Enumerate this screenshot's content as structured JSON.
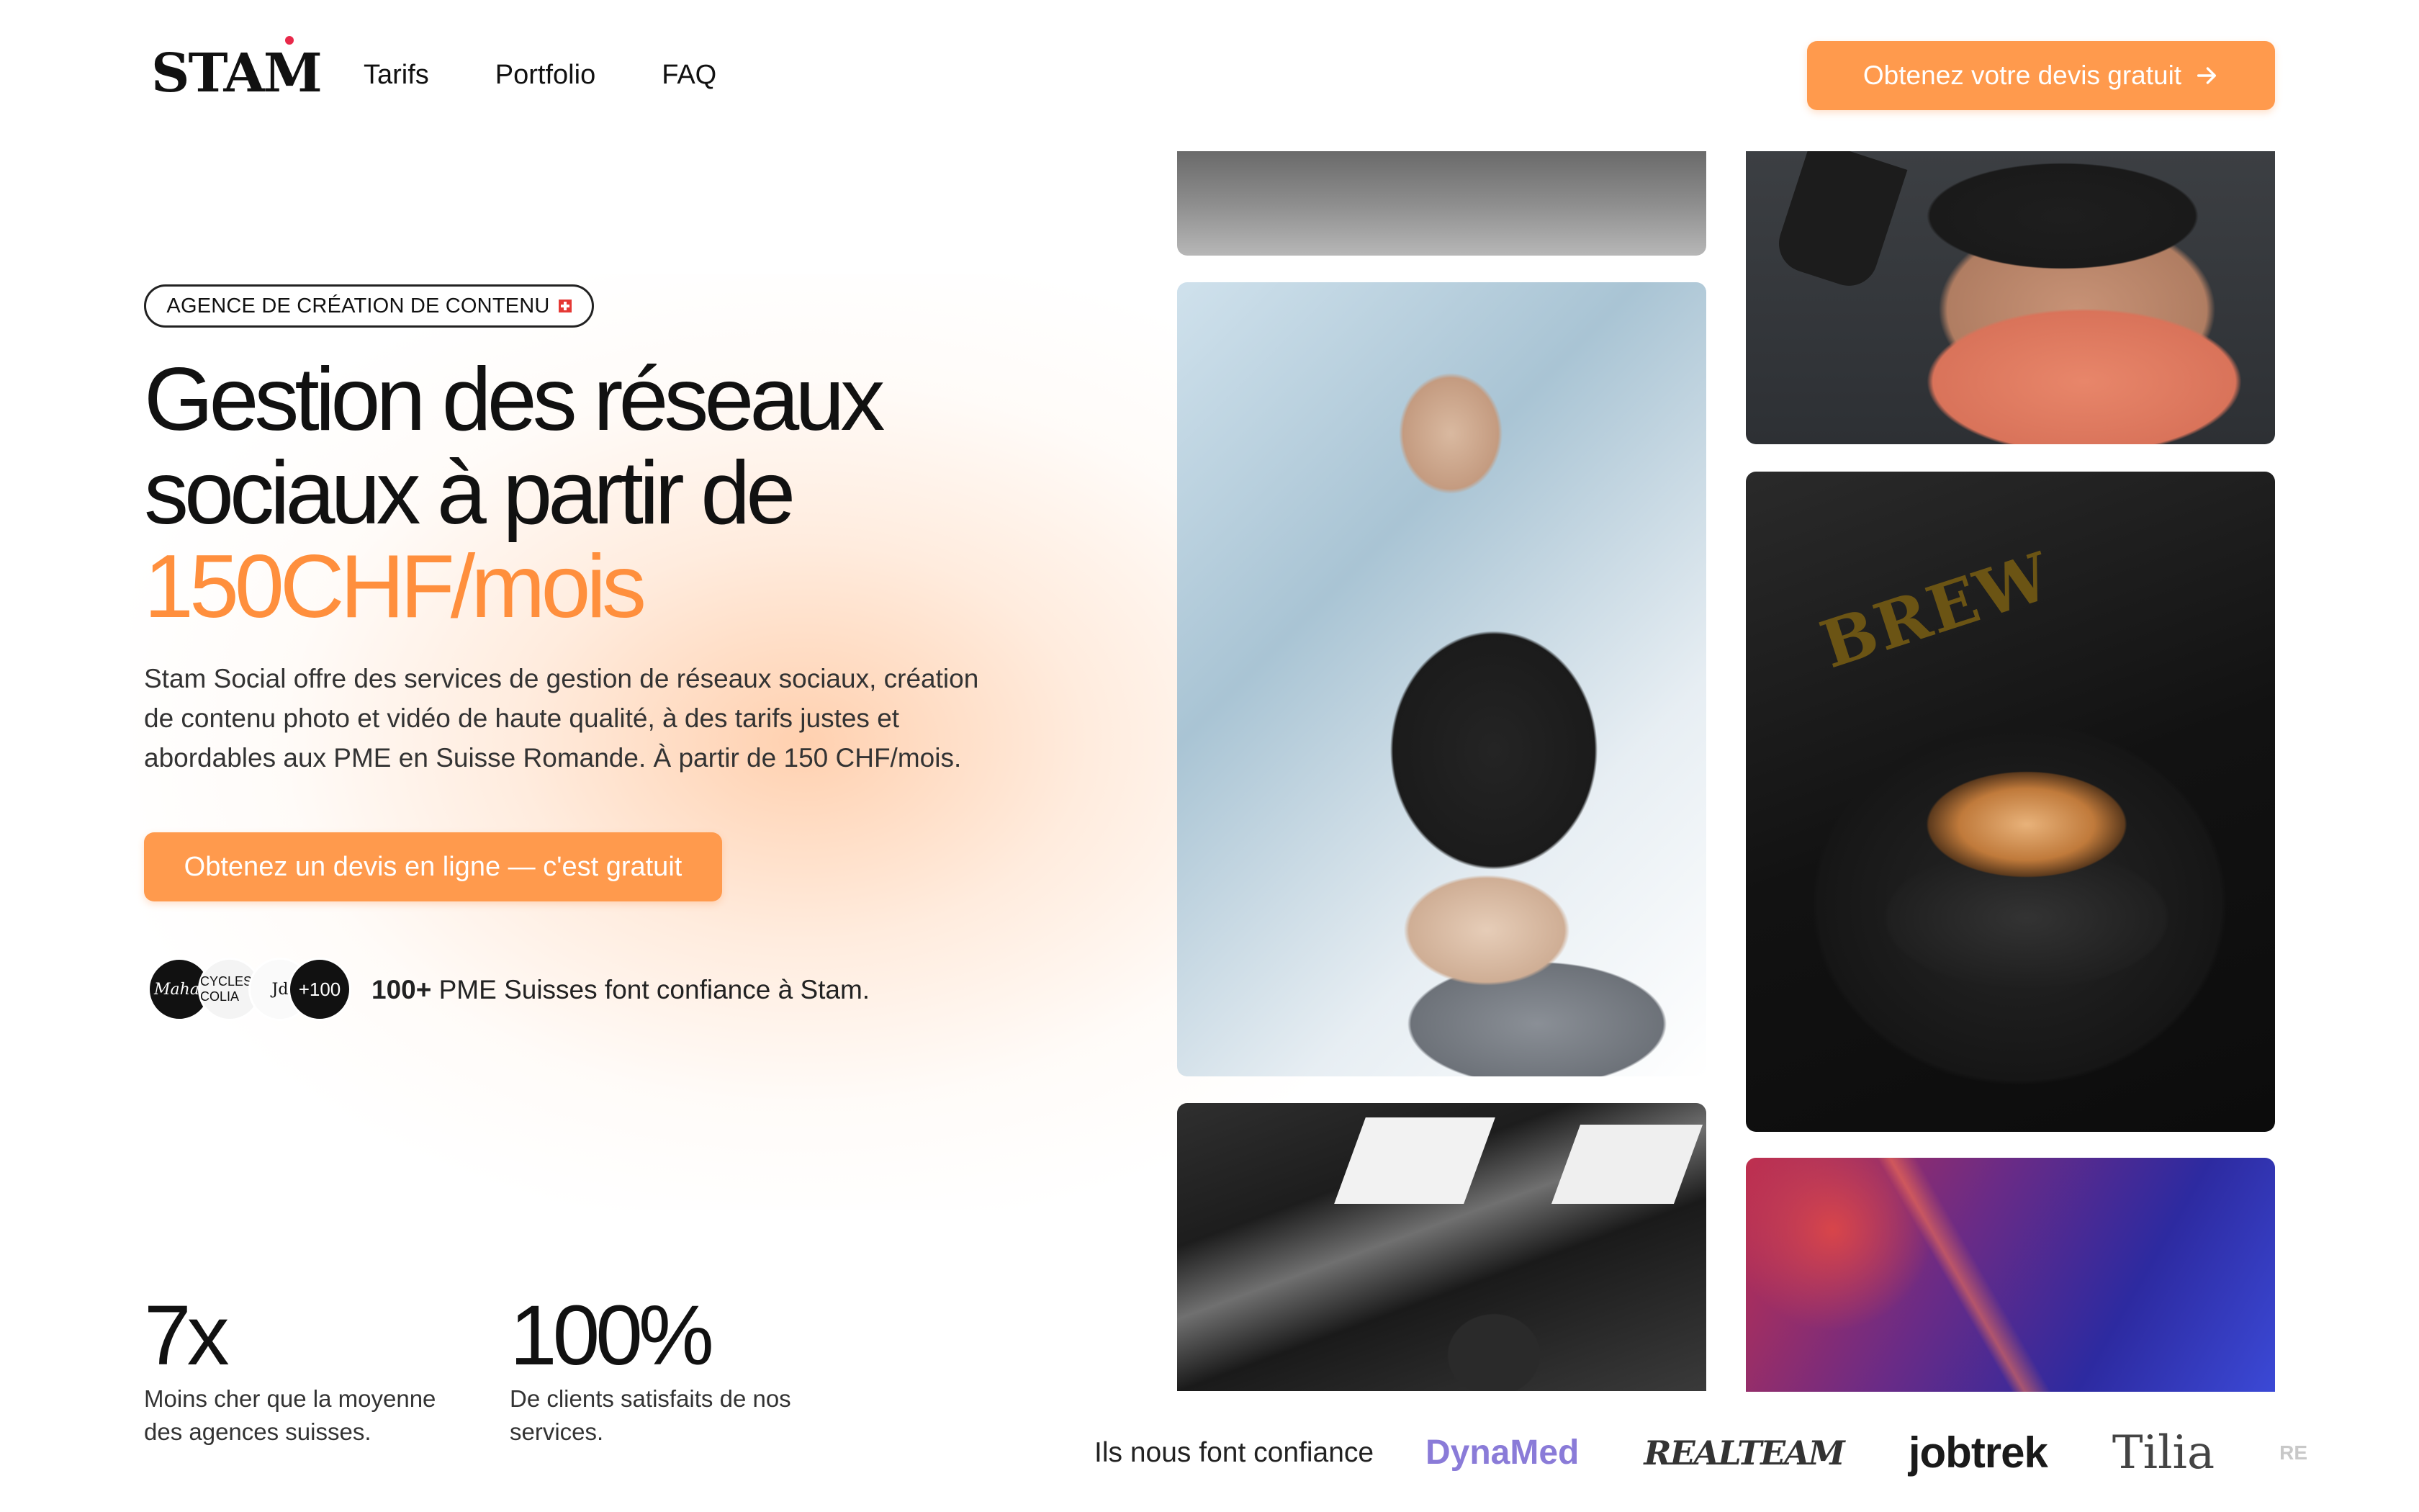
{
  "header": {
    "logo": "STAM",
    "nav": [
      {
        "label": "Tarifs"
      },
      {
        "label": "Portfolio"
      },
      {
        "label": "FAQ"
      }
    ],
    "cta_label": "Obtenez votre devis gratuit",
    "cta_icon": "arrow-right-icon"
  },
  "hero": {
    "badge": "AGENCE DE CRÉATION DE CONTENU",
    "headline_line1": "Gestion des réseaux",
    "headline_line2": "sociaux à partir de",
    "headline_price": "150CHF/mois",
    "description": "Stam Social offre des services de gestion de réseaux sociaux, création de contenu photo et vidéo de haute qualité, à des tarifs justes et abordables aux PME en Suisse Romande. À partir de 150 CHF/mois.",
    "cta_label": "Obtenez un devis en ligne — c'est gratuit",
    "accent_color": "#ff9a4d"
  },
  "trust": {
    "avatars": [
      "Mahal",
      "CYCLES COLIA",
      "Jd",
      "+100"
    ],
    "count": "100+",
    "text": "PME Suisses font confiance à Stam."
  },
  "stats": [
    {
      "value": "7x",
      "label": "Moins cher que la moyenne des agences suisses."
    },
    {
      "value": "100%",
      "label": "De clients satisfaits de nos services."
    }
  ],
  "logos": {
    "title": "Ils nous font confiance",
    "brands": [
      "DynaMed",
      "REALTEAM",
      "jobtrek",
      "Tilia",
      "RE"
    ]
  }
}
